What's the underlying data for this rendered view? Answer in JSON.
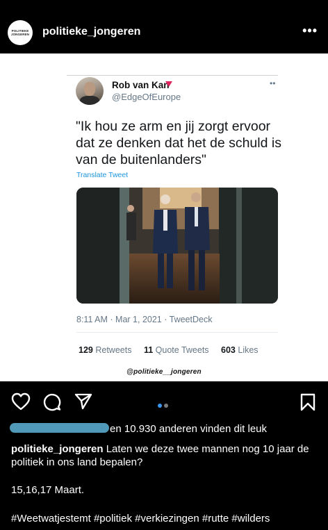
{
  "post": {
    "username": "politieke_jongeren",
    "avatar_text": [
      "POLITIEKE",
      "JONGEREN"
    ],
    "more_icon": "more-horizontal-icon"
  },
  "tweet": {
    "name": "Rob van Kan",
    "handle": "@EdgeOfEurope",
    "text": "\"Ik hou ze arm en jij zorgt ervoor dat ze denken dat het de schuld is van de buitenlanders\"",
    "translate": "Translate Tweet",
    "time": "8:11 AM · Mar 1, 2021 · TweetDeck",
    "retweets_count": "129",
    "retweets_label": "Retweets",
    "quotes_count": "11",
    "quotes_label": "Quote Tweets",
    "likes_count": "603",
    "likes_label": "Likes",
    "watermark": "@politieke__jongeren"
  },
  "actions": {
    "icons": [
      "heart-icon",
      "comment-icon",
      "send-icon",
      "bookmark-icon"
    ],
    "carousel_count": 2,
    "carousel_active": 1,
    "accent": "#3897f0"
  },
  "likes_text": "en 10.930 anderen vinden dit leuk",
  "caption": {
    "username": "politieke_jongeren",
    "text": "Laten we deze twee mannen nog 10 jaar de politiek in ons land bepalen?",
    "dates": "15,16,17 Maart.",
    "hashtags": "#Weetwatjestemt #politiek #verkiezingen #rutte #wilders"
  }
}
